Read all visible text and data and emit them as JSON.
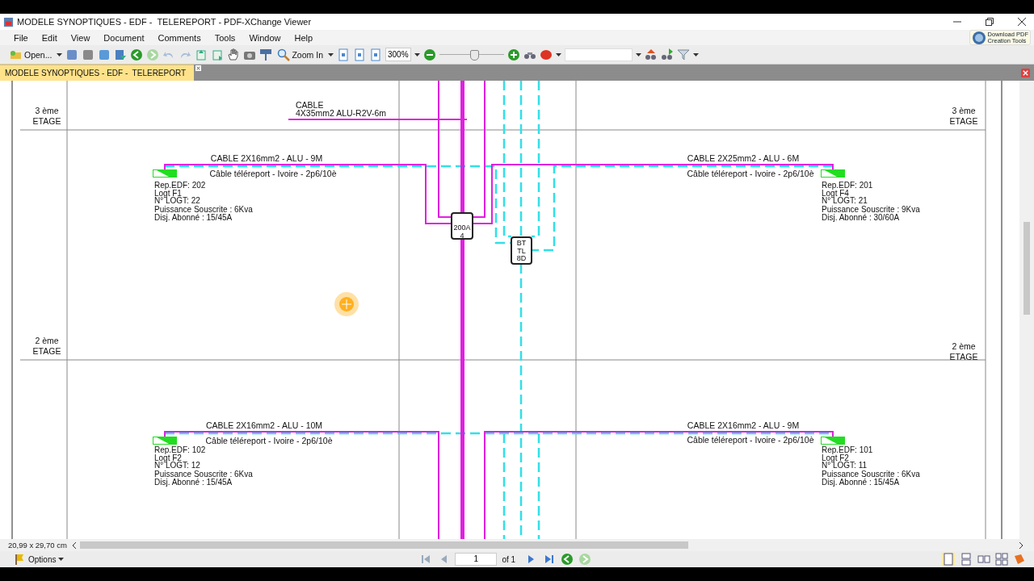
{
  "window": {
    "title": "MODELE SYNOPTIQUES - EDF -  TELEREPORT - PDF-XChange Viewer"
  },
  "menu": [
    "File",
    "Edit",
    "View",
    "Document",
    "Comments",
    "Tools",
    "Window",
    "Help"
  ],
  "toolbar": {
    "open_label": "Open...",
    "zoom_label": "Zoom In",
    "zoom_value": "300%",
    "zoom_slider": {
      "level": 0.52
    },
    "promo": [
      "Download PDF",
      "Creation Tools"
    ]
  },
  "tabs": [
    {
      "label": "MODELE SYNOPTIQUES - EDF -  TELEREPORT",
      "selected": true
    }
  ],
  "diagram": {
    "floors": [
      {
        "left": [
          "3 ème",
          "ETAGE"
        ],
        "right": [
          "3 ème",
          "ETAGE"
        ]
      },
      {
        "left": [
          "2 ème",
          "ETAGE"
        ],
        "right": [
          "2 ème",
          "ETAGE"
        ]
      }
    ],
    "riser_cable": [
      "CABLE",
      "4X35mm2 ALU-R2V-6m"
    ],
    "breaker": [
      "200A",
      "4"
    ],
    "telereport_box": [
      "BT",
      "TL",
      "8D"
    ],
    "apartments": [
      {
        "cable": "CABLE 2X16mm2 - ALU - 9M",
        "telereport": "Câble téléreport - Ivoire - 2p6/10è",
        "info": [
          "Rep.EDF: 202",
          "Logt F1",
          "N° LOGT: 22",
          "Puissance Souscrite : 6Kva",
          "Disj. Abonné : 15/45A"
        ]
      },
      {
        "cable": "CABLE 2X25mm2 - ALU - 6M",
        "telereport": "Câble téléreport - Ivoire - 2p6/10è",
        "info": [
          "Rep.EDF: 201",
          "Logt F4",
          "N° LOGT: 21",
          "Puissance Souscrite : 9Kva",
          "Disj. Abonné : 30/60A"
        ]
      },
      {
        "cable": "CABLE 2X16mm2 - ALU - 10M",
        "telereport": "Câble téléreport - Ivoire - 2p6/10è",
        "info": [
          "Rep.EDF: 102",
          "Logt F2",
          "N° LOGT: 12",
          "Puissance Souscrite : 6Kva",
          "Disj. Abonné : 15/45A"
        ]
      },
      {
        "cable": "CABLE 2X16mm2 - ALU - 9M",
        "telereport": "Câble téléreport - Ivoire - 2p6/10è",
        "info": [
          "Rep.EDF: 101",
          "Logt F2",
          "N° LOGT: 11",
          "Puissance Souscrite : 6Kva",
          "Disj. Abonné : 15/45A"
        ]
      }
    ]
  },
  "status": {
    "page_size": "20,99 x 29,70 cm",
    "options": "Options",
    "page": "1",
    "page_total": "of 1"
  }
}
